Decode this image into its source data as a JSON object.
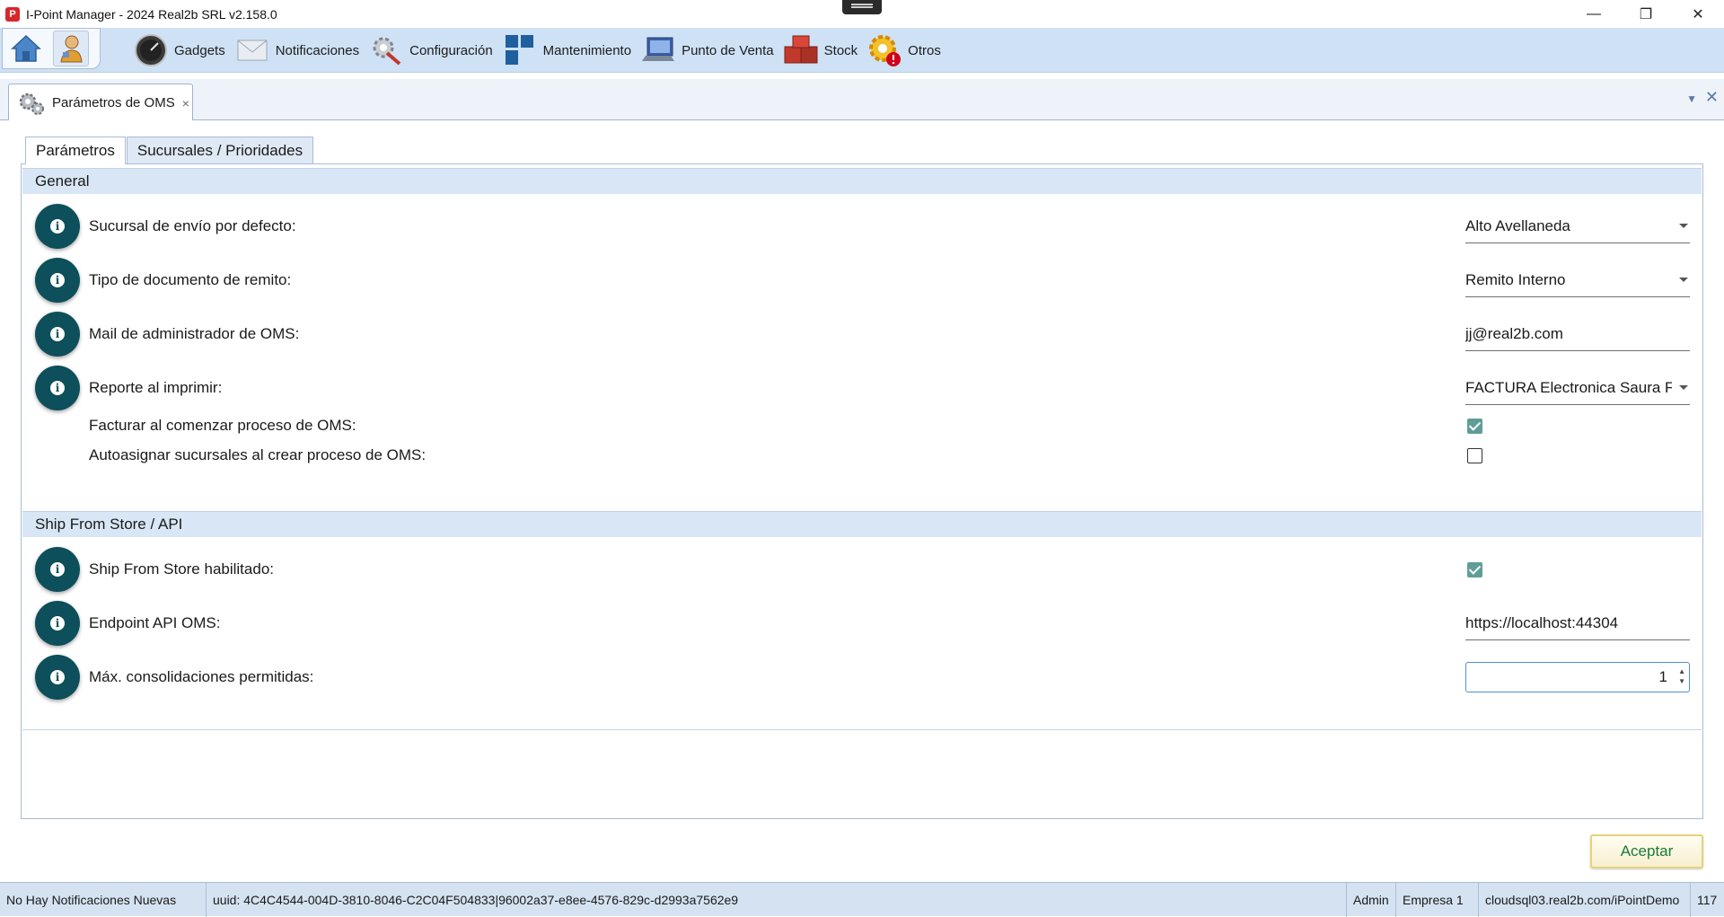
{
  "window": {
    "title": "I-Point Manager - 2024 Real2b SRL v2.158.0",
    "app_icon_letter": "P",
    "minimize": "—",
    "restore": "❐",
    "close": "✕"
  },
  "ribbon": {
    "items": [
      {
        "label": "Gadgets",
        "icon": "gauge-icon"
      },
      {
        "label": "Notificaciones",
        "icon": "envelope-icon"
      },
      {
        "label": "Configuración",
        "icon": "wrench-gear-icon"
      },
      {
        "label": "Mantenimiento",
        "icon": "blocks-icon"
      },
      {
        "label": "Punto de Venta",
        "icon": "pos-terminal-icon"
      },
      {
        "label": "Stock",
        "icon": "boxes-icon"
      },
      {
        "label": "Otros",
        "icon": "gear-alert-icon"
      }
    ]
  },
  "doc_tab": {
    "label": "Parámetros de OMS",
    "close": "×"
  },
  "strip": {
    "menu": "▼",
    "close": "✕"
  },
  "tabs": [
    {
      "label": "Parámetros",
      "active": true
    },
    {
      "label": "Sucursales / Prioridades",
      "active": false
    }
  ],
  "general": {
    "header": "General",
    "rows": [
      {
        "label": "Sucursal de envío por defecto:",
        "value": "Alto Avellaneda",
        "type": "dropdown"
      },
      {
        "label": "Tipo de documento de remito:",
        "value": "Remito Interno",
        "type": "dropdown"
      },
      {
        "label": "Mail de administrador de OMS:",
        "value": "jj@real2b.com",
        "type": "text"
      },
      {
        "label": "Reporte al imprimir:",
        "value": "FACTURA Electronica Saura F",
        "type": "dropdown"
      },
      {
        "label": "Facturar al comenzar proceso de OMS:",
        "checked": true,
        "type": "checkbox"
      },
      {
        "label": "Autoasignar sucursales al crear proceso de OMS:",
        "checked": false,
        "type": "checkbox"
      }
    ]
  },
  "ship": {
    "header": "Ship From Store / API",
    "rows": [
      {
        "label": "Ship From Store habilitado:",
        "checked": true,
        "type": "checkbox"
      },
      {
        "label": "Endpoint API OMS:",
        "value": "https://localhost:44304",
        "type": "text"
      },
      {
        "label": "Máx. consolidaciones permitidas:",
        "value": "1",
        "type": "spinner"
      }
    ]
  },
  "info_glyph": "i",
  "accept_label": "Aceptar",
  "status": {
    "notifications": "No Hay Notificaciones Nuevas",
    "uuid": "uuid: 4C4C4544-004D-3810-8046-C2C04F504833|96002a37-e8ee-4576-829c-d2993a7562e9",
    "user": "Admin",
    "company": "Empresa 1",
    "server": "cloudsql03.real2b.com/iPointDemo",
    "code": "117"
  }
}
